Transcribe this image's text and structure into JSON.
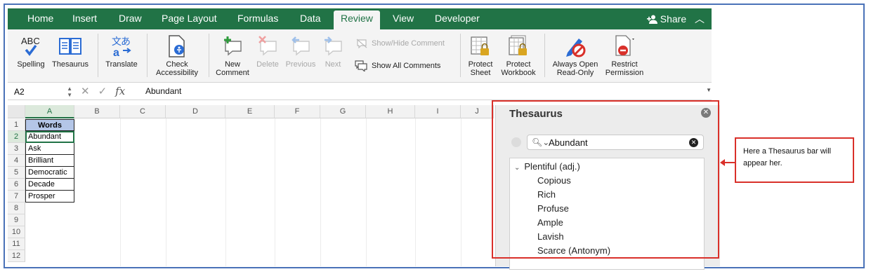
{
  "tabs": [
    {
      "label": "Home",
      "active": false
    },
    {
      "label": "Insert",
      "active": false
    },
    {
      "label": "Draw",
      "active": false
    },
    {
      "label": "Page Layout",
      "active": false
    },
    {
      "label": "Formulas",
      "active": false
    },
    {
      "label": "Data",
      "active": false
    },
    {
      "label": "Review",
      "active": true
    },
    {
      "label": "View",
      "active": false
    },
    {
      "label": "Developer",
      "active": false
    }
  ],
  "share_label": "Share",
  "ribbon": {
    "spelling": "Spelling",
    "spelling_icon_text": "ABC",
    "thesaurus": "Thesaurus",
    "translate": "Translate",
    "check_accessibility_1": "Check",
    "check_accessibility_2": "Accessibility",
    "new_comment_1": "New",
    "new_comment_2": "Comment",
    "delete": "Delete",
    "previous": "Previous",
    "next": "Next",
    "show_hide_comment": "Show/Hide Comment",
    "show_all_comments": "Show All Comments",
    "protect_sheet_1": "Protect",
    "protect_sheet_2": "Sheet",
    "protect_workbook_1": "Protect",
    "protect_workbook_2": "Workbook",
    "always_open_1": "Always Open",
    "always_open_2": "Read-Only",
    "restrict_1": "Restrict",
    "restrict_2": "Permission"
  },
  "formula_bar": {
    "name_box": "A2",
    "fx": "fx",
    "content": "Abundant"
  },
  "grid": {
    "columns": [
      "A",
      "B",
      "C",
      "D",
      "E",
      "F",
      "G",
      "H",
      "I",
      "J"
    ],
    "rows": [
      "1",
      "2",
      "3",
      "4",
      "5",
      "6",
      "7",
      "8",
      "9",
      "10",
      "11",
      "12"
    ],
    "column_a": [
      "Words",
      "Abundant",
      "Ask",
      "Brilliant",
      "Democratic",
      "Decade",
      "Prosper"
    ]
  },
  "thesaurus": {
    "title": "Thesaurus",
    "search_value": "Abundant",
    "sense": "Plentiful (adj.)",
    "synonyms": [
      "Copious",
      "Rich",
      "Profuse",
      "Ample",
      "Lavish",
      "Scarce (Antonym)"
    ]
  },
  "annotation": {
    "text": "Here a Thesaurus bar will appear her."
  },
  "colors": {
    "excel_green": "#217346",
    "frame_blue": "#4a72b8",
    "annotation_red": "#d9302a",
    "header_fill": "#b4c6e7"
  }
}
